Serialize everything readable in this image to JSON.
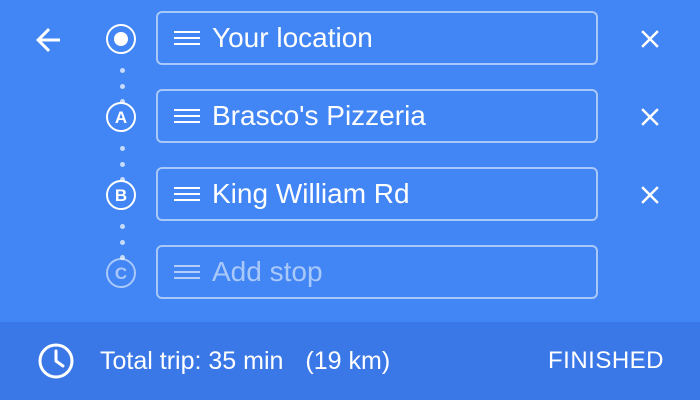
{
  "header": {
    "back_icon": "arrow-left-icon"
  },
  "stops": [
    {
      "marker": "",
      "marker_type": "origin",
      "value": "Your location",
      "placeholder": "",
      "removable": true
    },
    {
      "marker": "A",
      "marker_type": "letter",
      "value": "Brasco's Pizzeria",
      "placeholder": "",
      "removable": true
    },
    {
      "marker": "B",
      "marker_type": "letter",
      "value": "King William Rd",
      "placeholder": "",
      "removable": true
    },
    {
      "marker": "C",
      "marker_type": "letter-dim",
      "value": "",
      "placeholder": "Add stop",
      "removable": false
    }
  ],
  "icons": {
    "drag": "drag-handle-icon",
    "remove": "close-icon",
    "clock": "clock-icon"
  },
  "footer": {
    "trip_time": "Total trip: 35 min",
    "trip_distance": "(19 km)",
    "finished_label": "FINISHED"
  },
  "colors": {
    "primary": "#4285f4",
    "footer": "#3b78e7",
    "text": "#ffffff"
  }
}
